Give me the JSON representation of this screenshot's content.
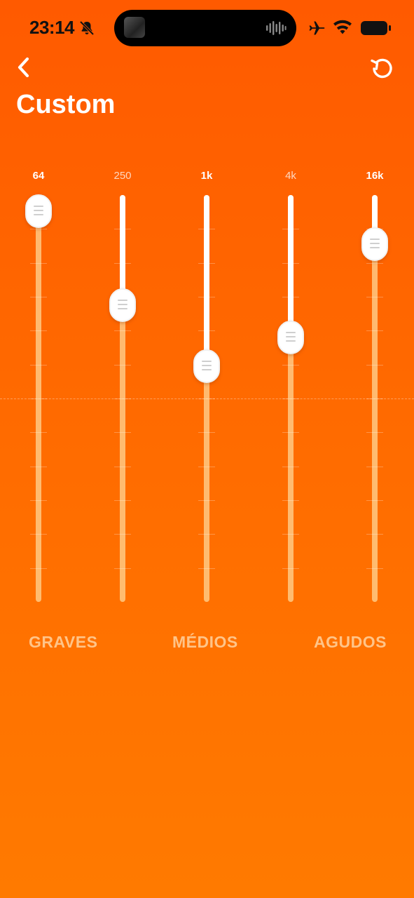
{
  "status_bar": {
    "time": "23:14",
    "icons": [
      "bell-slash-icon",
      "album-art-icon",
      "audio-wave-icon",
      "airplane-icon",
      "wifi-icon",
      "battery-icon"
    ]
  },
  "header": {
    "title": "Custom",
    "icons": [
      "chevron-left-icon",
      "reset-icon"
    ]
  },
  "equalizer": {
    "bands": [
      {
        "label": "64",
        "emphasis": true,
        "level": 0.96
      },
      {
        "label": "250",
        "emphasis": false,
        "level": 0.73
      },
      {
        "label": "1k",
        "emphasis": true,
        "level": 0.58
      },
      {
        "label": "4k",
        "emphasis": false,
        "level": 0.65
      },
      {
        "label": "16k",
        "emphasis": true,
        "level": 0.88
      }
    ],
    "groups": [
      "GRAVES",
      "MÉDIOS",
      "AGUDOS"
    ]
  },
  "colors": {
    "background_top": "#ff5a00",
    "background_bottom": "#ff7a00",
    "track_filled": "#ffd696",
    "track_rest": "#ffffff",
    "knob": "#ffffff"
  }
}
